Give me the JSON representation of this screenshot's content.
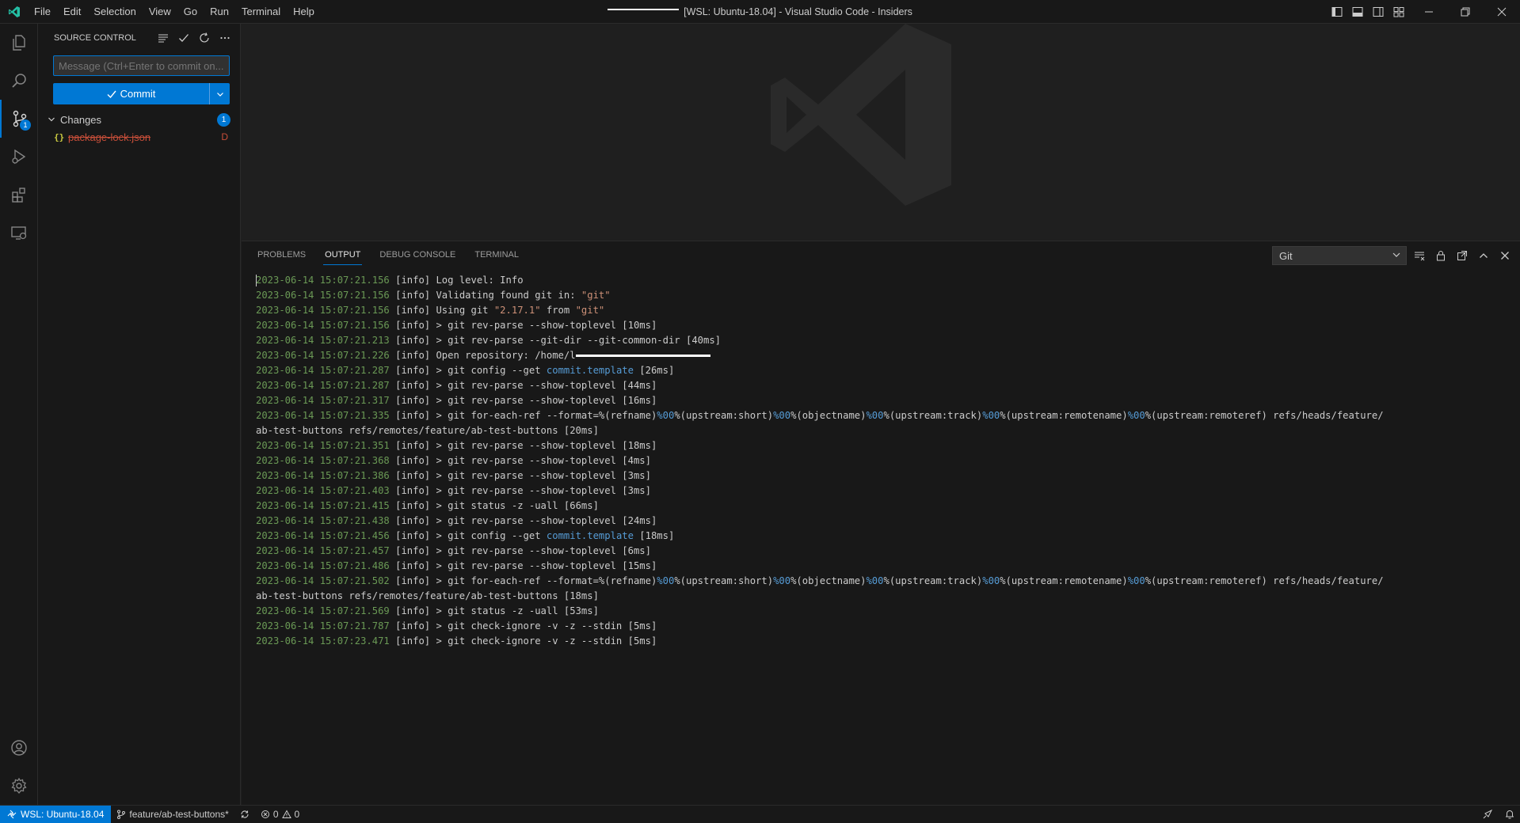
{
  "window": {
    "title": "[WSL: Ubuntu-18.04] - Visual Studio Code - Insiders"
  },
  "menu": [
    "File",
    "Edit",
    "Selection",
    "View",
    "Go",
    "Run",
    "Terminal",
    "Help"
  ],
  "activity_bar": {
    "scm_badge": "1"
  },
  "sidebar": {
    "title": "SOURCE CONTROL",
    "message_placeholder": "Message (Ctrl+Enter to commit on...",
    "commit_label": "Commit",
    "changes_label": "Changes",
    "changes_count": "1",
    "files": [
      {
        "name": "package-lock.json",
        "status": "D",
        "icon": "{}"
      }
    ]
  },
  "panel": {
    "tabs": [
      "PROBLEMS",
      "OUTPUT",
      "DEBUG CONSOLE",
      "TERMINAL"
    ],
    "active_tab": "OUTPUT",
    "channel": "Git",
    "lines": [
      {
        "ts": "2023-06-14 15:07:21.156",
        "text": " [info] Log level: Info"
      },
      {
        "ts": "2023-06-14 15:07:21.156",
        "text": " [info] Validating found git in: ",
        "str": "\"git\""
      },
      {
        "ts": "2023-06-14 15:07:21.156",
        "text": " [info] Using git ",
        "str": "\"2.17.1\"",
        "after": " from ",
        "str2": "\"git\""
      },
      {
        "ts": "2023-06-14 15:07:21.156",
        "text": " [info] > git rev-parse --show-toplevel [10ms]"
      },
      {
        "ts": "2023-06-14 15:07:21.213",
        "text": " [info] > git rev-parse --git-dir --git-common-dir [40ms]"
      },
      {
        "ts": "2023-06-14 15:07:21.226",
        "text": " [info] Open repository: /home/l",
        "redact": true
      },
      {
        "ts": "2023-06-14 15:07:21.287",
        "text": " [info] > git config --get ",
        "kw": "commit.template",
        "after": " [26ms]"
      },
      {
        "ts": "2023-06-14 15:07:21.287",
        "text": " [info] > git rev-parse --show-toplevel [44ms]"
      },
      {
        "ts": "2023-06-14 15:07:21.317",
        "text": " [info] > git rev-parse --show-toplevel [16ms]"
      },
      {
        "ts": "2023-06-14 15:07:21.335",
        "text": " [info] > git for-each-ref --format=%(refname)",
        "foreach": true
      },
      {
        "ts": "",
        "text": "ab-test-buttons refs/remotes/feature/ab-test-buttons [20ms]"
      },
      {
        "ts": "2023-06-14 15:07:21.351",
        "text": " [info] > git rev-parse --show-toplevel [18ms]"
      },
      {
        "ts": "2023-06-14 15:07:21.368",
        "text": " [info] > git rev-parse --show-toplevel [4ms]"
      },
      {
        "ts": "2023-06-14 15:07:21.386",
        "text": " [info] > git rev-parse --show-toplevel [3ms]"
      },
      {
        "ts": "2023-06-14 15:07:21.403",
        "text": " [info] > git rev-parse --show-toplevel [3ms]"
      },
      {
        "ts": "2023-06-14 15:07:21.415",
        "text": " [info] > git status -z -uall [66ms]"
      },
      {
        "ts": "2023-06-14 15:07:21.438",
        "text": " [info] > git rev-parse --show-toplevel [24ms]"
      },
      {
        "ts": "2023-06-14 15:07:21.456",
        "text": " [info] > git config --get ",
        "kw": "commit.template",
        "after": " [18ms]"
      },
      {
        "ts": "2023-06-14 15:07:21.457",
        "text": " [info] > git rev-parse --show-toplevel [6ms]"
      },
      {
        "ts": "2023-06-14 15:07:21.486",
        "text": " [info] > git rev-parse --show-toplevel [15ms]"
      },
      {
        "ts": "2023-06-14 15:07:21.502",
        "text": " [info] > git for-each-ref --format=%(refname)",
        "foreach": true
      },
      {
        "ts": "",
        "text": "ab-test-buttons refs/remotes/feature/ab-test-buttons [18ms]"
      },
      {
        "ts": "2023-06-14 15:07:21.569",
        "text": " [info] > git status -z -uall [53ms]"
      },
      {
        "ts": "2023-06-14 15:07:21.787",
        "text": " [info] > git check-ignore -v -z --stdin [5ms]"
      },
      {
        "ts": "2023-06-14 15:07:23.471",
        "text": " [info] > git check-ignore -v -z --stdin [5ms]"
      }
    ],
    "foreach_parts": [
      "%00",
      "%(upstream:short)",
      "%00",
      "%(objectname)",
      "%00",
      "%(upstream:track)",
      "%00",
      "%(upstream:remotename)",
      "%00",
      "%(upstream:remoteref) refs/heads/feature/"
    ]
  },
  "statusbar": {
    "remote": "WSL: Ubuntu-18.04",
    "branch": "feature/ab-test-buttons*",
    "errors": "0",
    "warnings": "0"
  },
  "colors": {
    "accent": "#0078d4",
    "timestamp": "#6a9955",
    "string": "#ce9178",
    "keyword": "#569cd6",
    "deleted": "#c74e39"
  }
}
